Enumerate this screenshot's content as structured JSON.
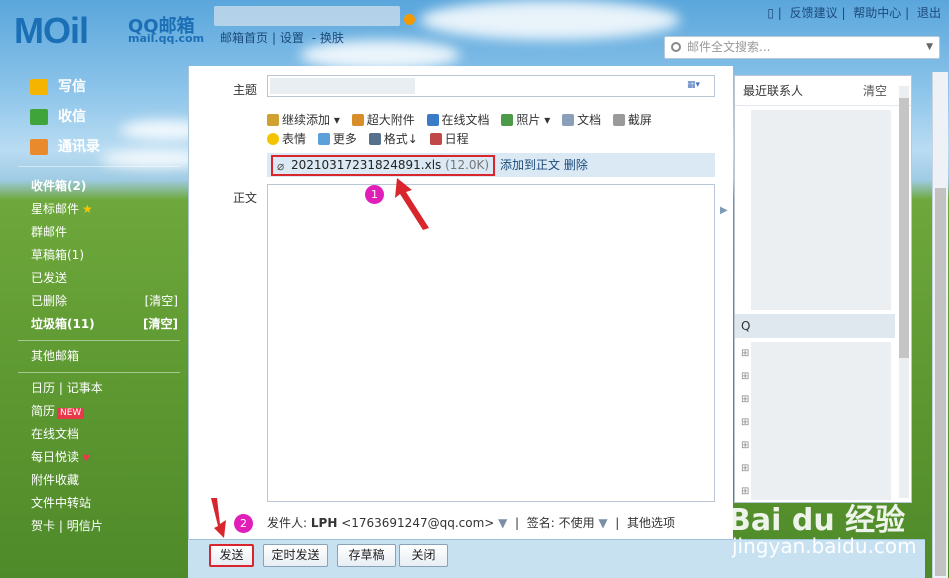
{
  "header": {
    "logo_text": "MOil",
    "brand_name": "QQ邮箱",
    "brand_url": "mail.qq.com",
    "links": [
      "邮箱首页",
      "设置",
      "换肤"
    ],
    "right_links": [
      "反馈建议",
      "帮助中心",
      "退出"
    ],
    "search_placeholder": "邮件全文搜索..."
  },
  "sidebar": {
    "primary": [
      {
        "label": "写信",
        "icon": "pencil-icon"
      },
      {
        "label": "收信",
        "icon": "inbox-download-icon"
      },
      {
        "label": "通讯录",
        "icon": "contact-card-icon"
      }
    ],
    "folders": [
      {
        "label": "收件箱(2)",
        "bold": true
      },
      {
        "label": "星标邮件",
        "star": true
      },
      {
        "label": "群邮件"
      },
      {
        "label": "草稿箱(1)"
      },
      {
        "label": "已发送"
      },
      {
        "label": "已删除",
        "action": "[清空]"
      },
      {
        "label": "垃圾箱(11)",
        "bold": true,
        "action": "[清空]"
      }
    ],
    "other": "其他邮箱",
    "apps": [
      {
        "label": "日历",
        "label2": "记事本"
      },
      {
        "label": "简历",
        "badge": "NEW"
      },
      {
        "label": "在线文档"
      },
      {
        "label": "每日悦读",
        "heart": true
      },
      {
        "label": "附件收藏"
      },
      {
        "label": "文件中转站"
      },
      {
        "label": "贺卡",
        "label2": "明信片"
      }
    ]
  },
  "compose": {
    "subject_label": "主题",
    "body_label": "正文",
    "toolbar_row1": [
      "继续添加",
      "超大附件",
      "在线文档",
      "照片",
      "文档",
      "截屏"
    ],
    "toolbar_row2": [
      "表情",
      "更多",
      "格式",
      "日程"
    ],
    "attachment": {
      "filename": "20210317231824891.xls",
      "size": "(12.0K)",
      "add_to_body": "添加到正文",
      "delete": "删除"
    },
    "sender_label": "发件人:",
    "sender_name": "LPH",
    "sender_email": "<1763691247@qq.com>",
    "signature_label": "签名:",
    "signature_value": "不使用",
    "other_options": "其他选项",
    "buttons": {
      "send": "发送",
      "schedule": "定时发送",
      "draft": "存草稿",
      "close": "关闭"
    }
  },
  "contacts": {
    "title": "最近联系人",
    "clear": "清空",
    "group_head": "Q"
  },
  "annotations": {
    "step1": "1",
    "step2": "2"
  },
  "watermark": {
    "line1": "Bai du 经验",
    "line2": "jingyan.baidu.com"
  },
  "colors": {
    "brand": "#1b6fb5",
    "highlight": "#d9262d",
    "step_marker": "#e21eb9"
  }
}
